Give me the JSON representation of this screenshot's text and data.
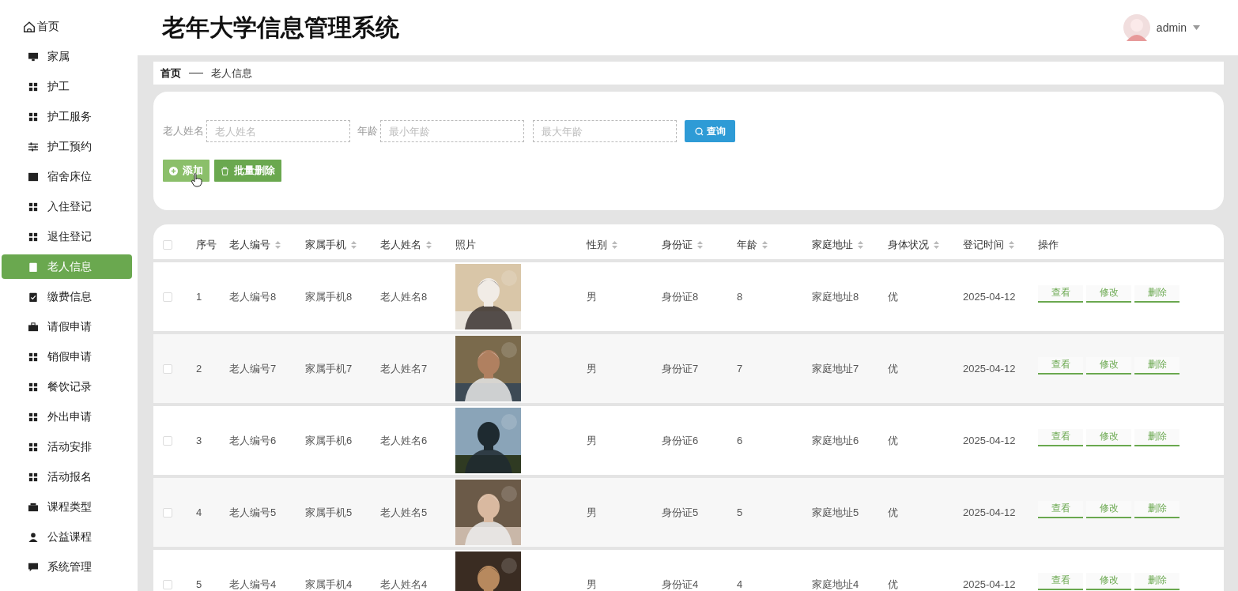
{
  "sidebar": {
    "items": [
      {
        "label": "首页",
        "selected": false
      },
      {
        "label": "家属",
        "selected": false
      },
      {
        "label": "护工",
        "selected": false
      },
      {
        "label": "护工服务",
        "selected": false
      },
      {
        "label": "护工预约",
        "selected": false
      },
      {
        "label": "宿舍床位",
        "selected": false
      },
      {
        "label": "入住登记",
        "selected": false
      },
      {
        "label": "退住登记",
        "selected": false
      },
      {
        "label": "老人信息",
        "selected": true
      },
      {
        "label": "缴费信息",
        "selected": false
      },
      {
        "label": "请假申请",
        "selected": false
      },
      {
        "label": "销假申请",
        "selected": false
      },
      {
        "label": "餐饮记录",
        "selected": false
      },
      {
        "label": "外出申请",
        "selected": false
      },
      {
        "label": "活动安排",
        "selected": false
      },
      {
        "label": "活动报名",
        "selected": false
      },
      {
        "label": "课程类型",
        "selected": false
      },
      {
        "label": "公益课程",
        "selected": false
      },
      {
        "label": "系统管理",
        "selected": false
      }
    ]
  },
  "header": {
    "title": "老年大学信息管理系统",
    "user": "admin"
  },
  "breadcrumb": [
    "首页",
    "老人信息"
  ],
  "search": {
    "name_label": "老人姓名",
    "name_placeholder": "老人姓名",
    "age_label": "年龄",
    "min_age_placeholder": "最小年龄",
    "max_age_placeholder": "最大年龄",
    "query_button": "查询"
  },
  "toolbar": [
    "添加",
    "批量删除"
  ],
  "table": {
    "select_all": {
      "checked": false
    },
    "columns": [
      {
        "label": "序号",
        "sortable": false
      },
      {
        "label": "老人编号",
        "sortable": true
      },
      {
        "label": "家属手机",
        "sortable": true
      },
      {
        "label": "老人姓名",
        "sortable": true
      },
      {
        "label": "照片",
        "sortable": false
      },
      {
        "label": "性别",
        "sortable": true
      },
      {
        "label": "身份证",
        "sortable": true
      },
      {
        "label": "年龄",
        "sortable": true
      },
      {
        "label": "家庭地址",
        "sortable": true
      },
      {
        "label": "身体状况",
        "sortable": true
      },
      {
        "label": "登记时间",
        "sortable": true
      },
      {
        "label": "操作",
        "sortable": false
      }
    ],
    "rows": [
      {
        "checked": false,
        "cells": [
          "1",
          "老人编号8",
          "家属手机8",
          "老人姓名8"
        ],
        "photo": {
          "kind": "picture"
        },
        "rest": [
          "男",
          "身份证8",
          "8",
          "家庭地址8",
          "优",
          "2025-04-12"
        ],
        "actions": [
          "查看",
          "修改",
          "删除"
        ]
      },
      {
        "checked": false,
        "cells": [
          "2",
          "老人编号7",
          "家属手机7",
          "老人姓名7"
        ],
        "photo": {
          "kind": "picture"
        },
        "rest": [
          "男",
          "身份证7",
          "7",
          "家庭地址7",
          "优",
          "2025-04-12"
        ],
        "actions": [
          "查看",
          "修改",
          "删除"
        ]
      },
      {
        "checked": false,
        "cells": [
          "3",
          "老人编号6",
          "家属手机6",
          "老人姓名6"
        ],
        "photo": {
          "kind": "picture"
        },
        "rest": [
          "男",
          "身份证6",
          "6",
          "家庭地址6",
          "优",
          "2025-04-12"
        ],
        "actions": [
          "查看",
          "修改",
          "删除"
        ]
      },
      {
        "checked": false,
        "cells": [
          "4",
          "老人编号5",
          "家属手机5",
          "老人姓名5"
        ],
        "photo": {
          "kind": "picture"
        },
        "rest": [
          "男",
          "身份证5",
          "5",
          "家庭地址5",
          "优",
          "2025-04-12"
        ],
        "actions": [
          "查看",
          "修改",
          "删除"
        ]
      },
      {
        "checked": false,
        "cells": [
          "5",
          "老人编号4",
          "家属手机4",
          "老人姓名4"
        ],
        "photo": {
          "kind": "picture"
        },
        "rest": [
          "男",
          "身份证4",
          "4",
          "家庭地址4",
          "优",
          "2025-04-12"
        ],
        "actions": [
          "查看",
          "修改",
          "删除"
        ]
      }
    ]
  }
}
